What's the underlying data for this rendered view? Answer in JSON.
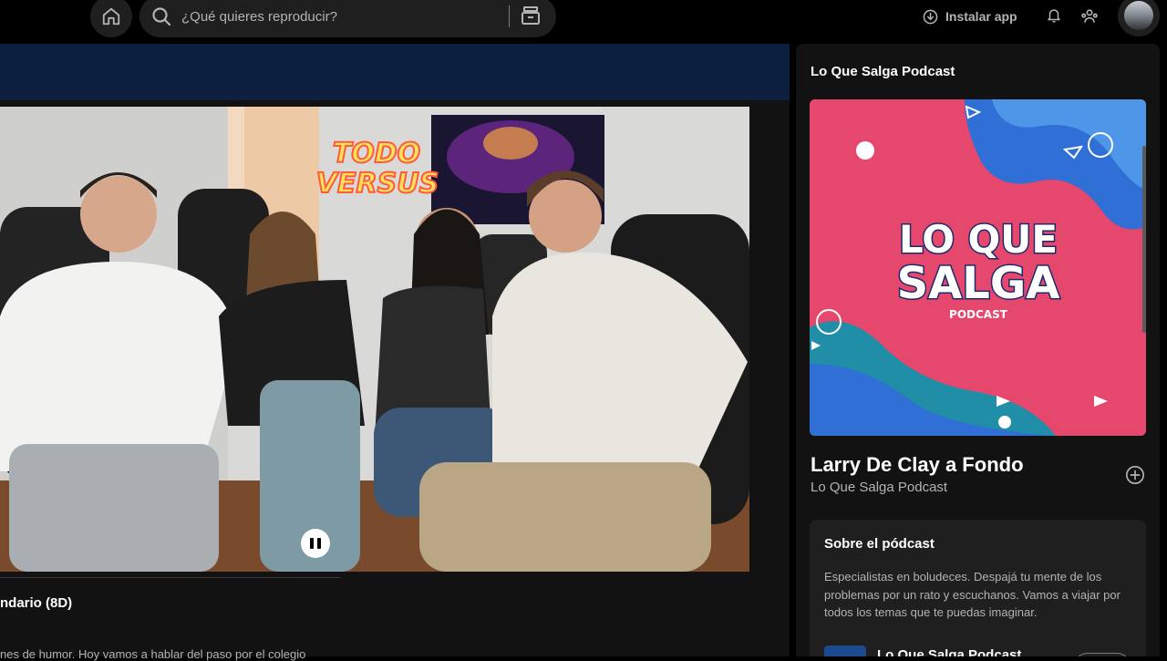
{
  "header": {
    "search_placeholder": "¿Qué quieres reproducir?",
    "install_label": "Instalar app"
  },
  "player": {
    "chapter_title": "ndario (8D)",
    "chapter_description": "nes de humor. Hoy vamos a hablar del paso por el colegio",
    "video_overlay_text": [
      "TODO",
      "VERSUS"
    ]
  },
  "panel": {
    "title": "Lo Que Salga Podcast",
    "cover_lines": [
      "LO QUE",
      "SALGA",
      "PODCAST"
    ],
    "episode_title": "Larry De Clay a Fondo",
    "episode_show": "Lo Que Salga Podcast",
    "about": {
      "heading": "Sobre el pódcast",
      "description": "Especialistas en boludeces. Despajá tu mente de los problemas por un rato y escuchanos. Vamos a viajar por todos los temas que te puedas imaginar.",
      "show_name": "Lo Que Salga Podcast"
    }
  },
  "colors": {
    "banner": "#0c1f3e",
    "cover_pink": "#e6476d",
    "cover_blue": "#2f6fd6",
    "cover_teal": "#1f8ea6"
  }
}
